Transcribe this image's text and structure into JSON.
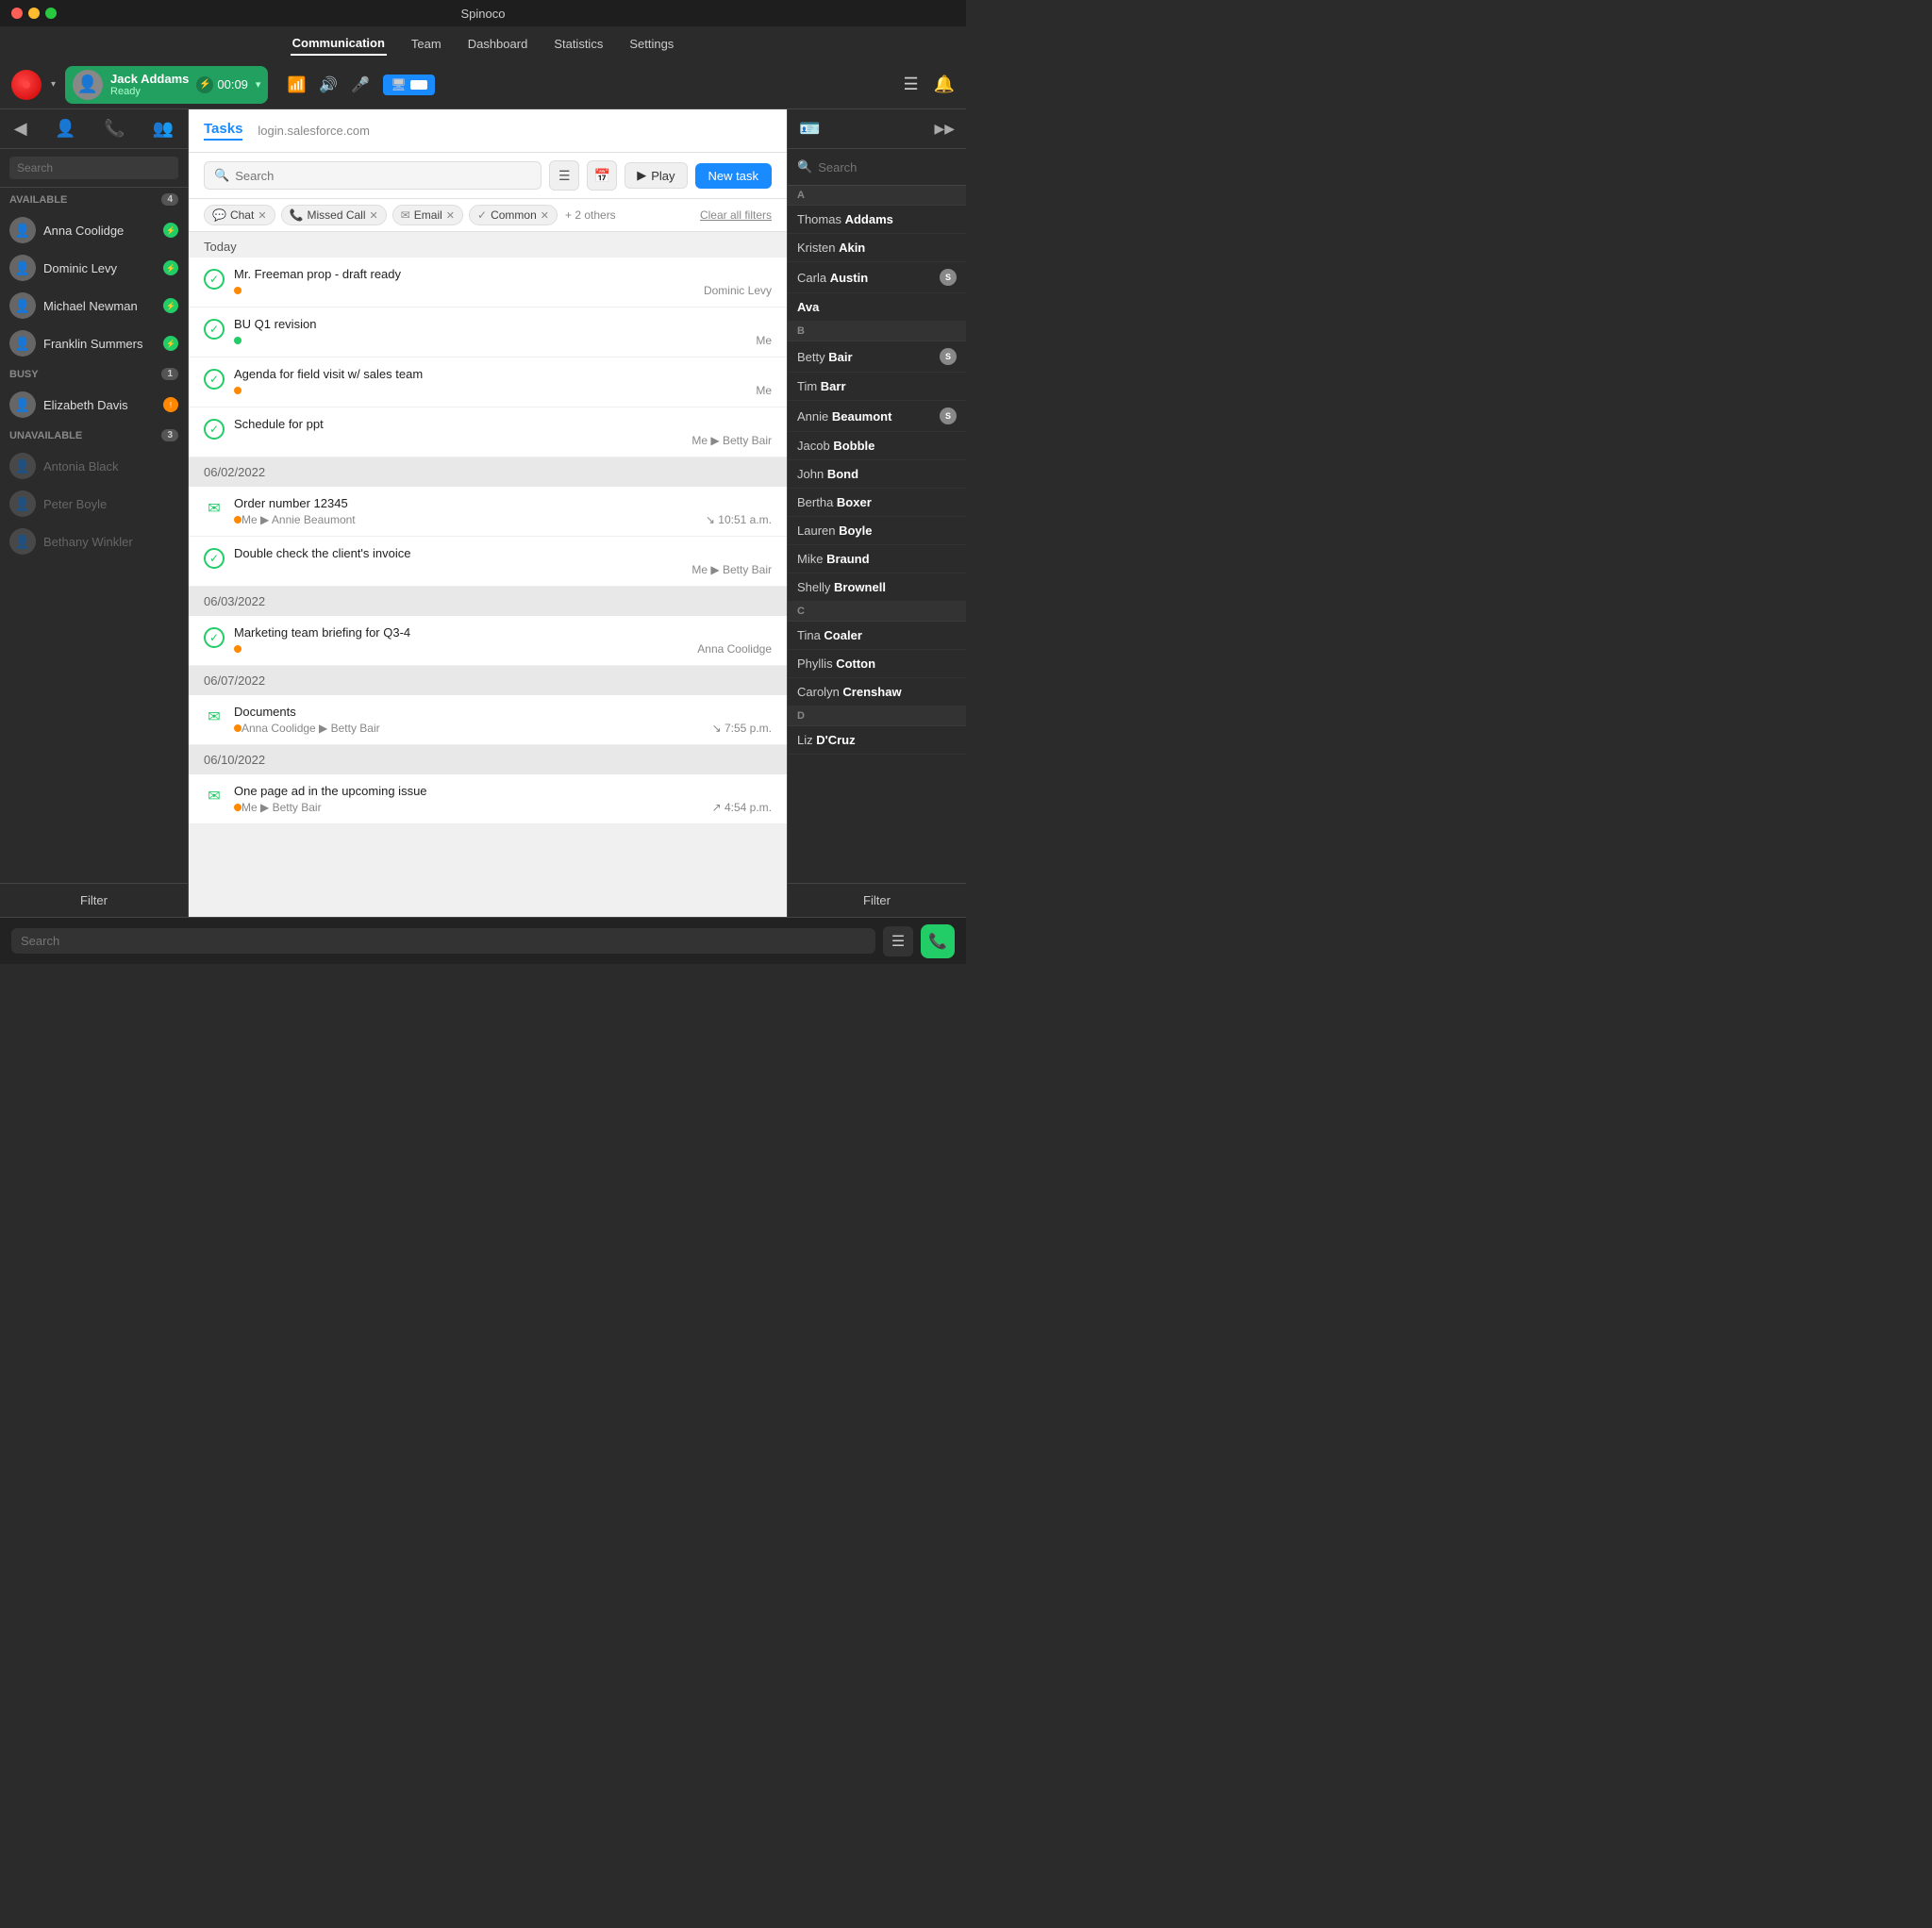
{
  "titleBar": {
    "title": "Spinoco"
  },
  "nav": {
    "items": [
      {
        "label": "Communication",
        "active": true
      },
      {
        "label": "Team",
        "active": false
      },
      {
        "label": "Dashboard",
        "active": false
      },
      {
        "label": "Statistics",
        "active": false
      },
      {
        "label": "Settings",
        "active": false
      }
    ]
  },
  "agentBar": {
    "agentName": "Jack Addams",
    "agentStatus": "Ready",
    "timerValue": "00:09"
  },
  "leftSidebar": {
    "searchPlaceholder": "Search",
    "sections": [
      {
        "name": "AVAILABLE",
        "count": 4,
        "agents": [
          {
            "name": "Anna Coolidge",
            "status": "green"
          },
          {
            "name": "Dominic Levy",
            "status": "green"
          },
          {
            "name": "Michael Newman",
            "status": "green"
          },
          {
            "name": "Franklin Summers",
            "status": "green"
          }
        ]
      },
      {
        "name": "BUSY",
        "count": 1,
        "agents": [
          {
            "name": "Elizabeth Davis",
            "status": "orange"
          }
        ]
      },
      {
        "name": "UNAVAILABLE",
        "count": 3,
        "agents": [
          {
            "name": "Antonia Black",
            "status": "unavailable"
          },
          {
            "name": "Peter Boyle",
            "status": "unavailable"
          },
          {
            "name": "Bethany Winkler",
            "status": "unavailable"
          }
        ]
      }
    ],
    "filterLabel": "Filter"
  },
  "tasksPanel": {
    "tab": "Tasks",
    "subtitle": "login.salesforce.com",
    "searchPlaceholder": "Search",
    "playLabel": "Play",
    "newTaskLabel": "New task",
    "filters": [
      {
        "icon": "💬",
        "label": "Chat"
      },
      {
        "icon": "📞",
        "label": "Missed Call"
      },
      {
        "icon": "✉",
        "label": "Email"
      },
      {
        "icon": "✓",
        "label": "Common"
      }
    ],
    "othersLabel": "+ 2 others",
    "clearFiltersLabel": "Clear all filters",
    "sections": [
      {
        "dateLabel": "Today",
        "isToday": true,
        "tasks": [
          {
            "type": "check",
            "title": "Mr. Freeman prop - draft ready",
            "priority": "orange",
            "assignee": "Dominic Levy",
            "time": ""
          },
          {
            "type": "check",
            "title": "BU Q1 revision",
            "priority": "green",
            "assignee": "Me",
            "time": ""
          },
          {
            "type": "check",
            "title": "Agenda for field visit w/ sales team",
            "priority": "orange",
            "assignee": "Me",
            "time": ""
          },
          {
            "type": "check",
            "title": "Schedule for ppt",
            "priority": "",
            "assignee": "Me ▶ Betty Bair",
            "time": ""
          }
        ]
      },
      {
        "dateLabel": "06/02/2022",
        "isToday": false,
        "tasks": [
          {
            "type": "email",
            "title": "Order number 12345",
            "priority": "orange",
            "assignee": "Me ▶ Annie Beaumont",
            "time": "↘ 10:51 a.m."
          },
          {
            "type": "check",
            "title": "Double check the client's invoice",
            "priority": "",
            "assignee": "Me ▶ Betty Bair",
            "time": ""
          }
        ]
      },
      {
        "dateLabel": "06/03/2022",
        "isToday": false,
        "tasks": [
          {
            "type": "check",
            "title": "Marketing team briefing for Q3-4",
            "priority": "orange",
            "assignee": "Anna Coolidge",
            "time": ""
          }
        ]
      },
      {
        "dateLabel": "06/07/2022",
        "isToday": false,
        "tasks": [
          {
            "type": "email",
            "title": "Documents",
            "priority": "orange",
            "assignee": "Anna Coolidge ▶ Betty Bair",
            "time": "↘ 7:55 p.m."
          }
        ]
      },
      {
        "dateLabel": "06/10/2022",
        "isToday": false,
        "tasks": [
          {
            "type": "email",
            "title": "One page ad in the upcoming issue",
            "priority": "orange",
            "assignee": "Me ▶ Betty Bair",
            "time": "↗ 4:54 p.m."
          }
        ]
      }
    ]
  },
  "rightSidebar": {
    "searchPlaceholder": "Search",
    "addLabel": "+",
    "sections": [
      {
        "letter": "A",
        "contacts": [
          {
            "first": "Thomas",
            "last": "Addams",
            "badge": null
          },
          {
            "first": "Kristen",
            "last": "Akin",
            "badge": null
          },
          {
            "first": "Carla",
            "last": "Austin",
            "badge": "S"
          },
          {
            "first": "Ava",
            "last": "",
            "badge": null
          }
        ]
      },
      {
        "letter": "B",
        "contacts": [
          {
            "first": "Betty",
            "last": "Bair",
            "badge": "S"
          },
          {
            "first": "Tim",
            "last": "Barr",
            "badge": null
          },
          {
            "first": "Annie",
            "last": "Beaumont",
            "badge": "S"
          },
          {
            "first": "Jacob",
            "last": "Bobble",
            "badge": null
          },
          {
            "first": "John",
            "last": "Bond",
            "badge": null
          },
          {
            "first": "Bertha",
            "last": "Boxer",
            "badge": null
          },
          {
            "first": "Lauren",
            "last": "Boyle",
            "badge": null
          },
          {
            "first": "Mike",
            "last": "Braund",
            "badge": null
          },
          {
            "first": "Shelly",
            "last": "Brownell",
            "badge": null
          }
        ]
      },
      {
        "letter": "C",
        "contacts": [
          {
            "first": "Tina",
            "last": "Coaler",
            "badge": null
          },
          {
            "first": "Phyllis",
            "last": "Cotton",
            "badge": null
          },
          {
            "first": "Carolyn",
            "last": "Crenshaw",
            "badge": null
          }
        ]
      },
      {
        "letter": "D",
        "contacts": [
          {
            "first": "Liz",
            "last": "D'Cruz",
            "badge": null
          }
        ]
      }
    ],
    "filterLabel": "Filter"
  },
  "bottomBar": {
    "searchPlaceholder": "Search"
  }
}
